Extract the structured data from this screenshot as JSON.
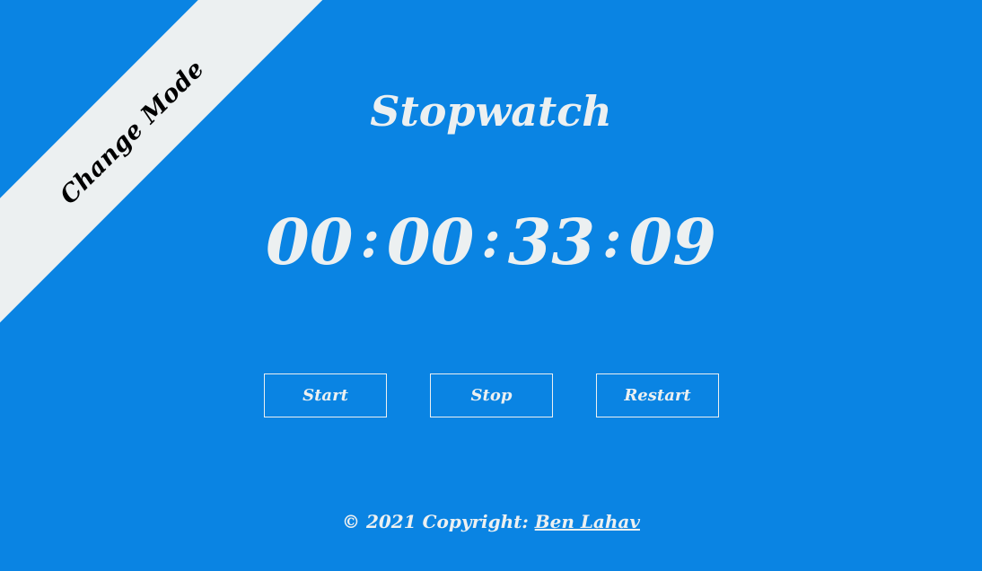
{
  "ribbon": {
    "label": "Change Mode"
  },
  "header": {
    "title": "Stopwatch"
  },
  "timer": {
    "hours": "00",
    "minutes": "00",
    "seconds": "33",
    "centiseconds": "09",
    "separator": ":"
  },
  "controls": {
    "start_label": "Start",
    "stop_label": "Stop",
    "restart_label": "Restart"
  },
  "footer": {
    "copyright_text": "© 2021 Copyright: ",
    "author_link": "Ben Lahav"
  },
  "colors": {
    "background": "#0a84e3",
    "foreground": "#ecf0f1",
    "ribbon": "#ecf0f1",
    "ribbon_text": "#000000"
  }
}
